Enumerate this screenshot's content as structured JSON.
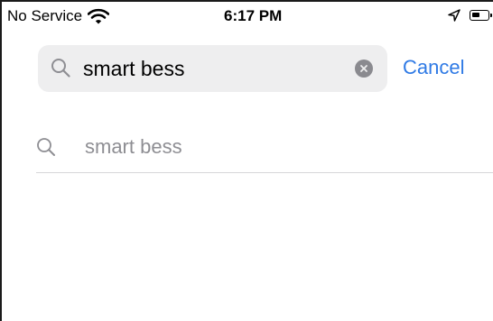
{
  "status_bar": {
    "carrier": "No Service",
    "time": "6:17 PM",
    "icons": [
      "wifi-icon",
      "location-arrow-icon",
      "battery-icon"
    ]
  },
  "search": {
    "value": "smart bess",
    "cancel_label": "Cancel"
  },
  "suggestions": [
    {
      "label": "smart bess"
    }
  ],
  "colors": {
    "accent": "#2f7ae5",
    "search_field_bg": "#eeeeef",
    "secondary_text": "#8e8e93"
  }
}
